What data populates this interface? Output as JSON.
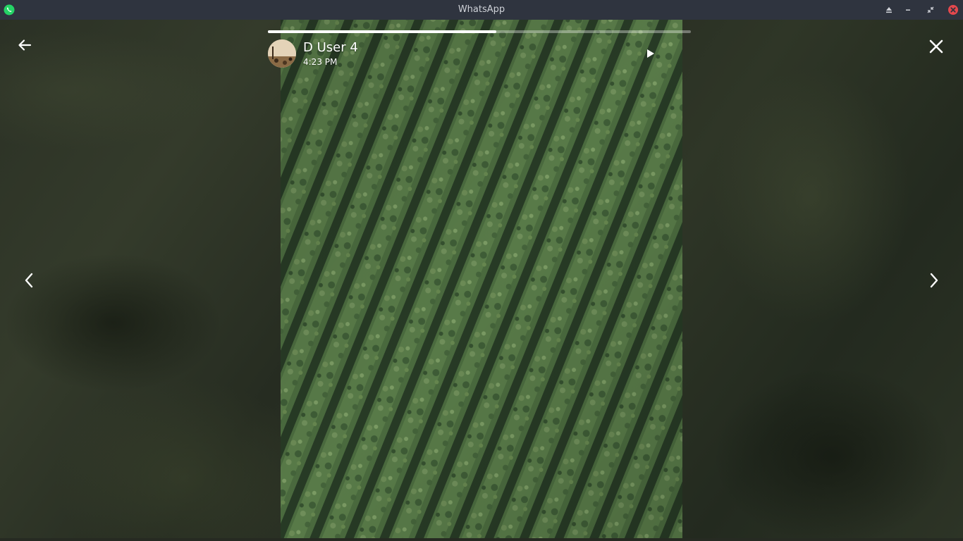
{
  "window": {
    "title": "WhatsApp",
    "app_icon": "whatsapp-logo-icon",
    "controls": [
      "eject-icon",
      "minimize-icon",
      "restore-icon",
      "close-window-icon"
    ]
  },
  "status_viewer": {
    "sender_name": "D User 4",
    "timestamp": "4:23 PM",
    "progress_fraction": 0.54,
    "icons": {
      "back": "arrow-left-icon",
      "close": "close-icon",
      "play": "play-icon",
      "previous": "chevron-left-icon",
      "next": "chevron-right-icon"
    }
  },
  "colors": {
    "titlebar": "#2f343f",
    "accent_green": "#25d366",
    "close_red": "#e5484d",
    "overlay_text": "#ffffff"
  }
}
